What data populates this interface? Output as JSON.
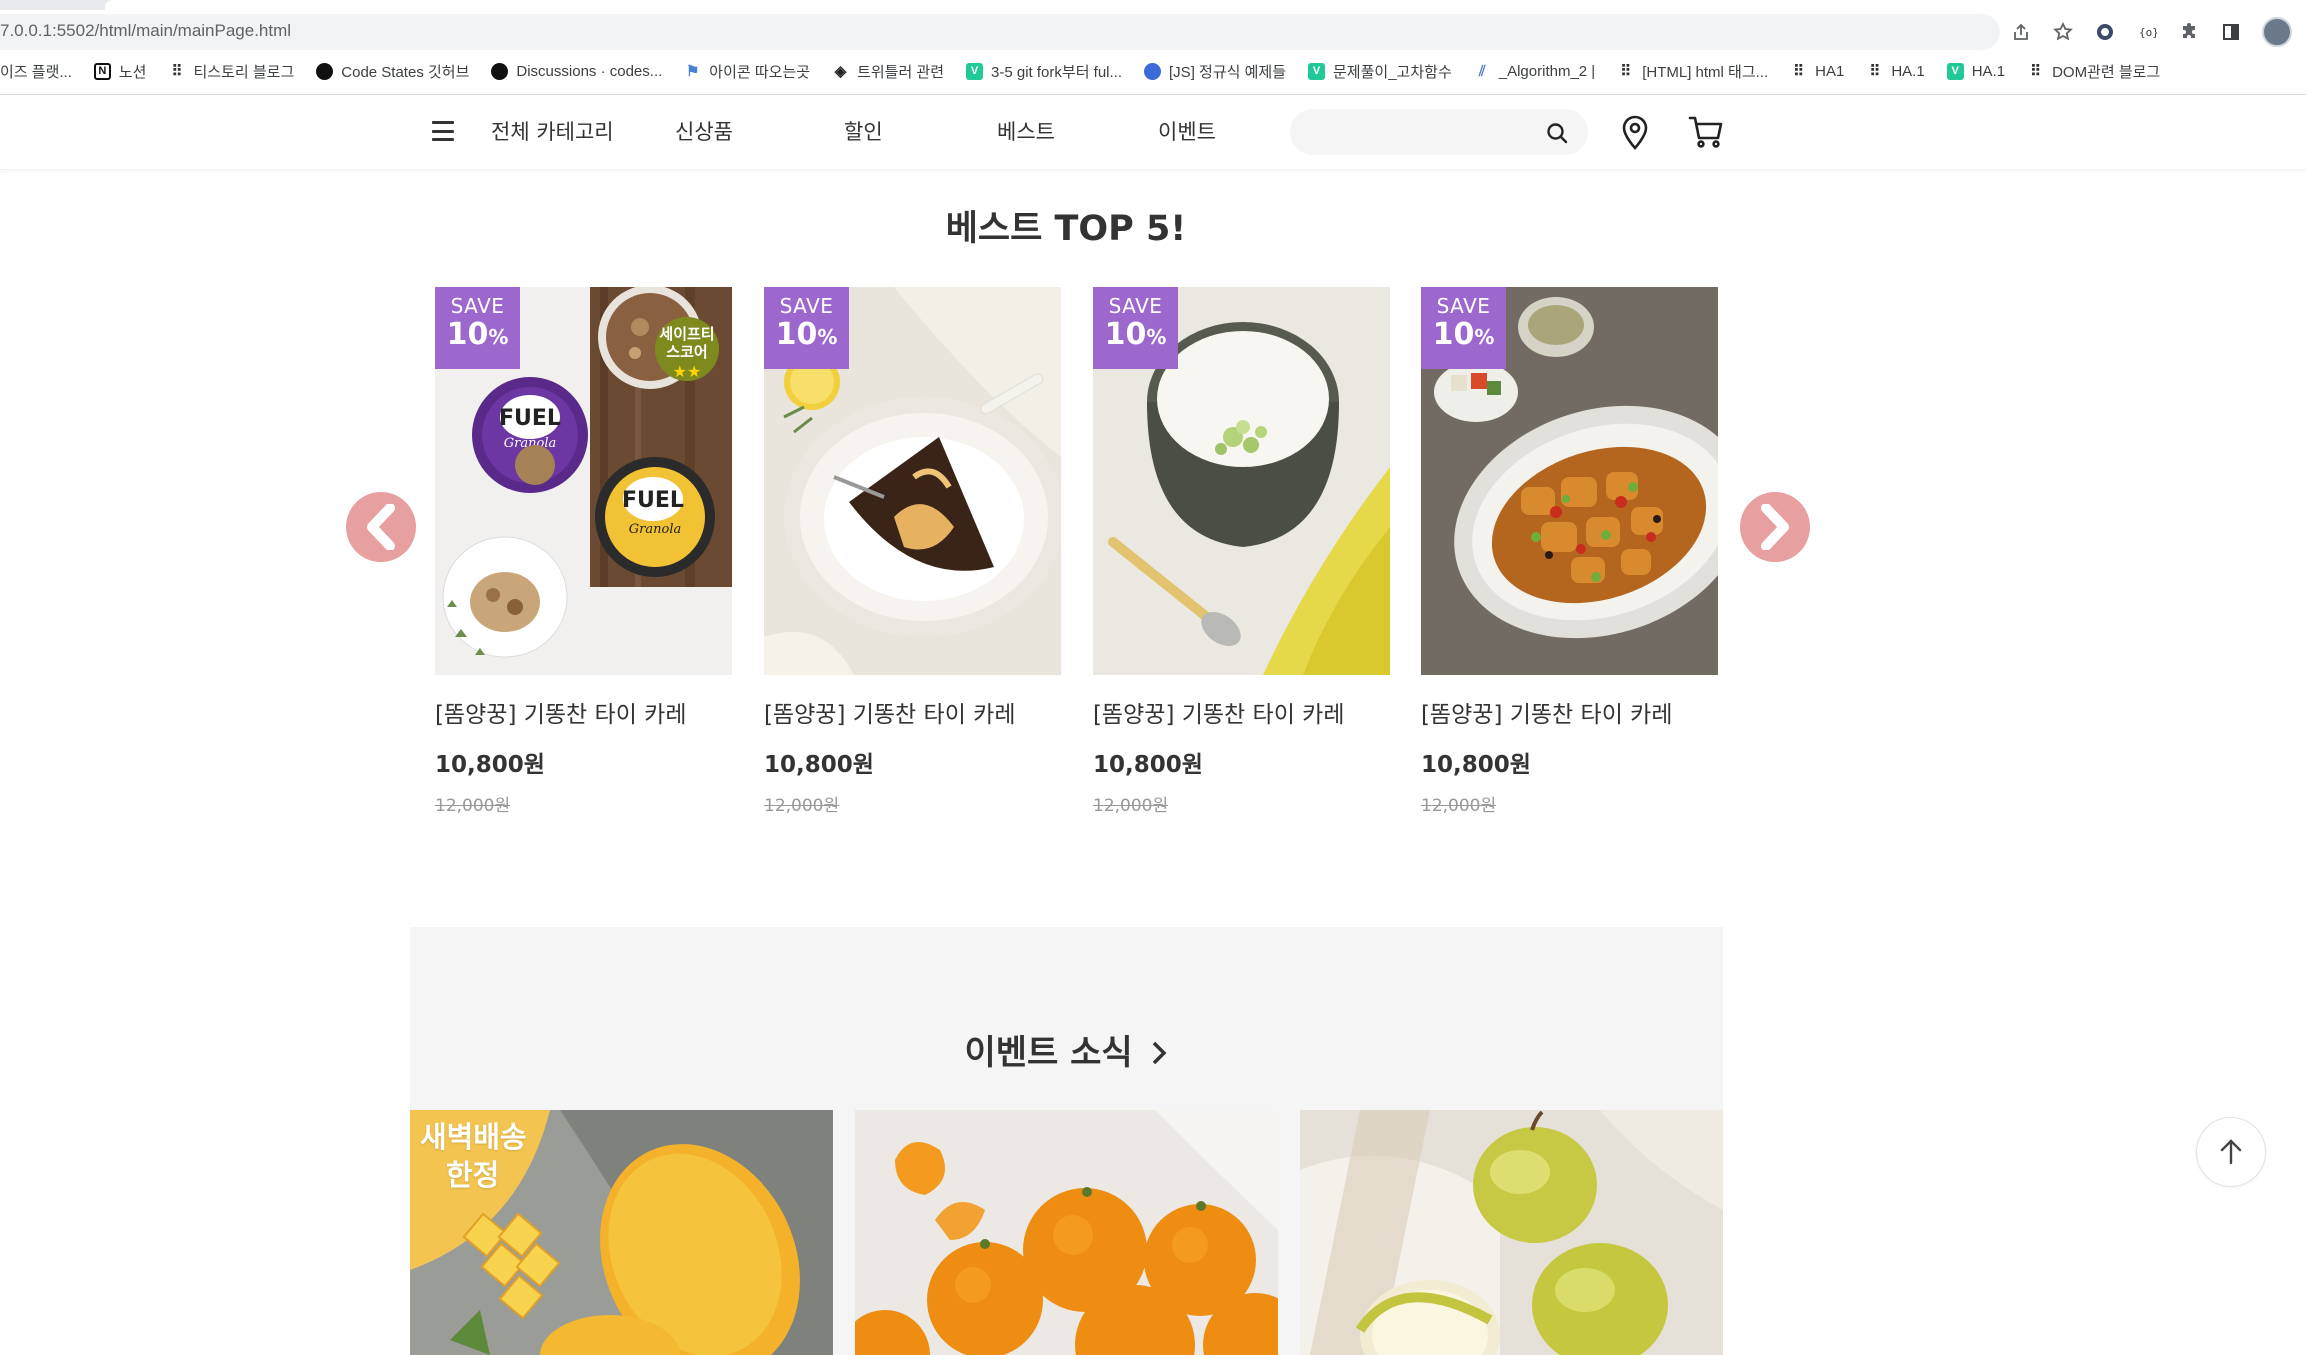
{
  "browser": {
    "url": "7.0.0.1:5502/html/main/mainPage.html",
    "bookmarks": [
      {
        "label": "이즈 플랫...",
        "icon": "none"
      },
      {
        "label": "노션",
        "icon": "notion-icon"
      },
      {
        "label": "티스토리 블로그",
        "icon": "tistory-icon"
      },
      {
        "label": "Code States 깃허브",
        "icon": "github-icon"
      },
      {
        "label": "Discussions · codes...",
        "icon": "github-icon"
      },
      {
        "label": "아이콘 따오는곳",
        "icon": "flag-icon"
      },
      {
        "label": "트위틀러 관련",
        "icon": "cube-icon"
      },
      {
        "label": "3-5 git fork부터 ful...",
        "icon": "velog-icon"
      },
      {
        "label": "[JS] 정규식 예제들",
        "icon": "blob-icon"
      },
      {
        "label": "문제풀이_고차함수",
        "icon": "velog-icon"
      },
      {
        "label": "_Algorithm_2 |",
        "icon": "stripe-icon"
      },
      {
        "label": "[HTML] html 태그...",
        "icon": "tistory-icon"
      },
      {
        "label": "HA1",
        "icon": "tistory-icon"
      },
      {
        "label": "HA.1",
        "icon": "tistory-icon"
      },
      {
        "label": "HA.1",
        "icon": "velog-icon"
      },
      {
        "label": "DOM관련 블로그",
        "icon": "tistory-icon"
      }
    ]
  },
  "header": {
    "nav": {
      "all_categories": "전체 카테고리",
      "new": "신상품",
      "sale": "할인",
      "best": "베스트",
      "event": "이벤트"
    },
    "search": {
      "value": "",
      "placeholder": ""
    }
  },
  "best": {
    "title": "베스트 TOP 5!",
    "products": [
      {
        "save_label": "SAVE",
        "save_pct": "10",
        "save_unit": "%",
        "name": "[똠양꿍] 기똥찬 타이 카레",
        "price": "10,800원",
        "orig_price": "12,000원",
        "image": "granola",
        "sticker": "세이프티\n스코어"
      },
      {
        "save_label": "SAVE",
        "save_pct": "10",
        "save_unit": "%",
        "name": "[똠양꿍] 기똥찬 타이 카레",
        "price": "10,800원",
        "orig_price": "12,000원",
        "image": "chocolate-cake"
      },
      {
        "save_label": "SAVE",
        "save_pct": "10",
        "save_unit": "%",
        "name": "[똠양꿍] 기똥찬 타이 카레",
        "price": "10,800원",
        "orig_price": "12,000원",
        "image": "porridge"
      },
      {
        "save_label": "SAVE",
        "save_pct": "10",
        "save_unit": "%",
        "name": "[똠양꿍] 기똥찬 타이 카레",
        "price": "10,800원",
        "orig_price": "12,000원",
        "image": "sweet-sour-pork"
      }
    ]
  },
  "event": {
    "title": "이벤트 소식",
    "cards": [
      {
        "image": "mango",
        "badge_line1": "새벽배송",
        "badge_line2": "한정"
      },
      {
        "image": "tangerine"
      },
      {
        "image": "apple"
      }
    ]
  },
  "colors": {
    "save_badge": "#9d68cd",
    "carousel_arrow": "#e79f9f",
    "event_bg": "#f5f5f5"
  }
}
